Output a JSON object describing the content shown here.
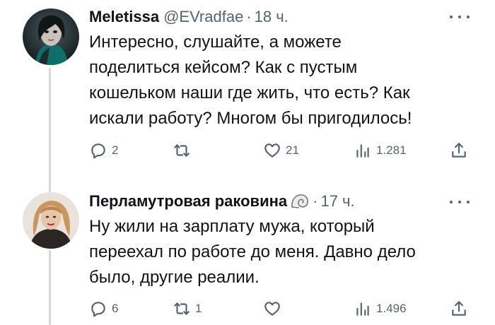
{
  "tweets": [
    {
      "author_name": "Meletissa",
      "handle": "@EVradfae",
      "separator": "·",
      "time": "18 ч.",
      "text": "Интересно, слушайте, а можете\nподелиться кейсом? Как с пустым\nкошельком наши где жить, что есть? Как\nискали работу? Многом бы пригодилось!",
      "avatar_icon": "dark-portrait-avatar",
      "actions": {
        "replies": "2",
        "retweets": "",
        "likes": "21",
        "views": "1.281"
      }
    },
    {
      "author_name": "Перламутровая раковина",
      "name_emoji_icon": "spiral-shell-icon",
      "separator": "·",
      "time": "17 ч.",
      "text": "Ну жили на зарплату мужа, который\nпереехал по работе до меня. Давно дело\nбыло, другие реалии.",
      "avatar_icon": "woman-portrait-avatar",
      "actions": {
        "replies": "6",
        "retweets": "1",
        "likes": "",
        "views": "1.496"
      }
    }
  ],
  "colors": {
    "primary_text": "#0f1419",
    "secondary_text": "#536471",
    "thread_line": "#cfd9de"
  }
}
